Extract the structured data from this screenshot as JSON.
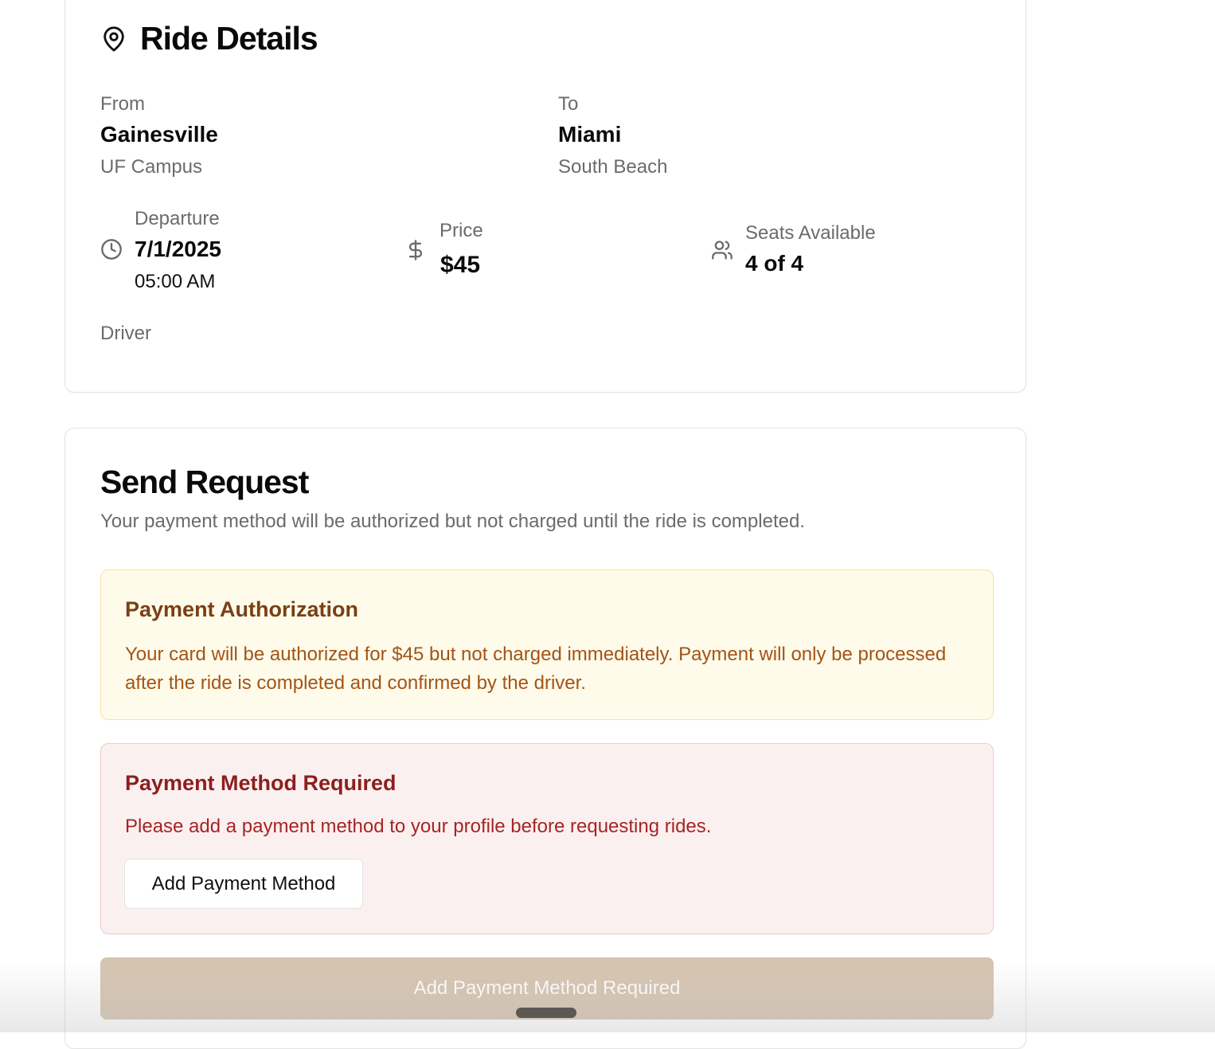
{
  "ride_details": {
    "title": "Ride Details",
    "title_icon": "map-pin-icon",
    "from": {
      "label": "From",
      "city": "Gainesville",
      "place": "UF Campus"
    },
    "to": {
      "label": "To",
      "city": "Miami",
      "place": "South Beach"
    },
    "departure": {
      "icon": "clock-icon",
      "label": "Departure",
      "date": "7/1/2025",
      "time": "05:00 AM"
    },
    "price": {
      "icon": "dollar-icon",
      "label": "Price",
      "value": "$45"
    },
    "seats": {
      "icon": "users-icon",
      "label": "Seats Available",
      "value": "4 of 4"
    },
    "driver": {
      "label": "Driver"
    }
  },
  "send_request": {
    "title": "Send Request",
    "description": "Your payment method will be authorized but not charged until the ride is completed.",
    "authorization_alert": {
      "title": "Payment Authorization",
      "text": "Your card will be authorized for $45 but not charged immediately. Payment will only be processed after the ride is completed and confirmed by the driver."
    },
    "payment_required_alert": {
      "title": "Payment Method Required",
      "text": "Please add a payment method to your profile before requesting rides.",
      "button_label": "Add Payment Method"
    },
    "submit_button_label": "Add Payment Method Required"
  },
  "colors": {
    "warning_bg": "#fefbea",
    "warning_text": "#a35418",
    "error_bg": "#fbf0f0",
    "error_text": "#a72424",
    "disabled_button": "#d6c4b0"
  }
}
